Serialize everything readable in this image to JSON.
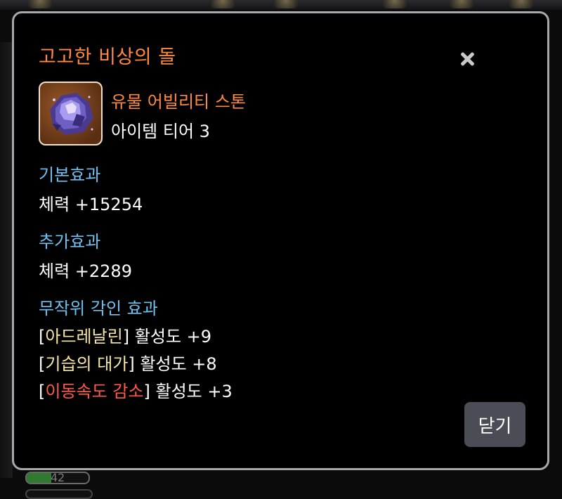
{
  "background": {
    "gauge_value": "42",
    "gauge_fill_fraction": 0.4
  },
  "modal": {
    "title": "고고한 비상의 돌",
    "item": {
      "name": "유물 어빌리티 스톤",
      "tier": "아이템 티어 3",
      "icon": "crystal-stone-icon"
    },
    "base_effect": {
      "label": "기본효과",
      "stat": "체력 +15254"
    },
    "bonus_effect": {
      "label": "추가효과",
      "stat": "체력 +2289"
    },
    "engravings": {
      "label": "무작위 각인 효과",
      "items": [
        {
          "name": "아드레날린",
          "value": "활성도 +9",
          "color": "#f6e7a8"
        },
        {
          "name": "기습의 대가",
          "value": "활성도 +8",
          "color": "#f6e7a8"
        },
        {
          "name": "이동속도 감소",
          "value": "활성도 +3",
          "color": "#ff5a4a"
        }
      ]
    },
    "close_button_label": "닫기"
  },
  "colors": {
    "title": "#ff8a3d",
    "section": "#6cc1f0",
    "border": "#a7a8ad",
    "button": "#4a4d55"
  }
}
